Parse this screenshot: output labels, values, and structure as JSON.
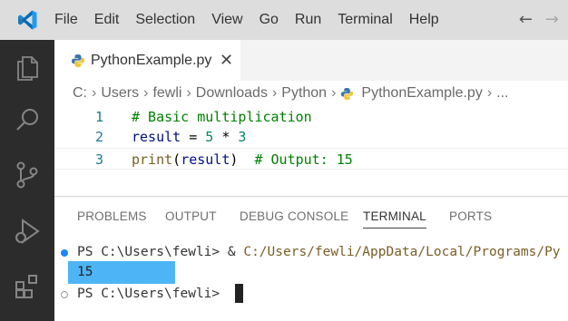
{
  "menu": [
    "File",
    "Edit",
    "Selection",
    "View",
    "Go",
    "Run",
    "Terminal",
    "Help"
  ],
  "nav": {
    "back": "←",
    "forward": "→"
  },
  "activity_bar": [
    "explorer-icon",
    "search-icon",
    "source-control-icon",
    "run-debug-icon",
    "extensions-icon"
  ],
  "tab": {
    "label": "PythonExample.py",
    "close": "✕"
  },
  "breadcrumb": {
    "parts": [
      "C:",
      "Users",
      "fewli",
      "Downloads",
      "Python",
      "PythonExample.py",
      "..."
    ],
    "separator": "›"
  },
  "editor": {
    "lines": [
      {
        "num": "1",
        "code": "# Basic multiplication"
      },
      {
        "num": "2",
        "code": "result = 5 * 3"
      },
      {
        "num": "3",
        "code": "print(result)  # Output: 15"
      }
    ],
    "current_line": 3
  },
  "panel": {
    "tabs": [
      "PROBLEMS",
      "OUTPUT",
      "DEBUG CONSOLE",
      "TERMINAL",
      "PORTS"
    ],
    "active_tab": "TERMINAL"
  },
  "terminal": {
    "line1_prompt": "PS C:\\Users\\fewli> ",
    "line1_cmd": "& ",
    "line1_path": "C:/Users/fewli/AppData/Local/Programs/Py",
    "output": "15",
    "line3_prompt": "PS C:\\Users\\fewli> "
  },
  "colors": {
    "titlebar": "#dddddd",
    "activity_bar": "#2c2c2c",
    "vscode_blue": "#23a9f2",
    "comment": "#008000",
    "number": "#098658",
    "function": "#795e26",
    "terminal_dot_active": "#1a85ff",
    "terminal_output_highlight": "#4db5f5"
  }
}
